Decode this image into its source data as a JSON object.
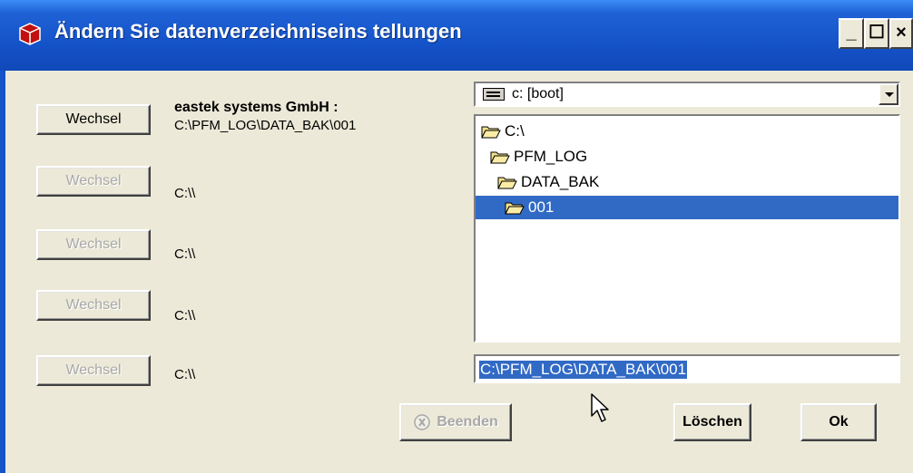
{
  "window": {
    "title": "Ändern Sie datenverzeichniseins tellungen",
    "minimize": "_",
    "maximize": "☐",
    "close": "×"
  },
  "rows": [
    {
      "button": "Wechsel",
      "enabled": true,
      "heading": "eastek systems GmbH :",
      "path": "C:\\PFM_LOG\\DATA_BAK\\001"
    },
    {
      "button": "Wechsel",
      "enabled": false,
      "path": "C:\\\\"
    },
    {
      "button": "Wechsel",
      "enabled": false,
      "path": "C:\\\\"
    },
    {
      "button": "Wechsel",
      "enabled": false,
      "path": "C:\\\\"
    },
    {
      "button": "Wechsel",
      "enabled": false,
      "path": "C:\\\\"
    }
  ],
  "drive_combo": {
    "value": "c: [boot]",
    "icon": "drive-icon"
  },
  "folder_tree": [
    {
      "label": "C:\\",
      "selected": false
    },
    {
      "label": "PFM_LOG",
      "selected": false
    },
    {
      "label": "DATA_BAK",
      "selected": false
    },
    {
      "label": "001",
      "selected": true
    }
  ],
  "path_field": {
    "value": "C:\\PFM_LOG\\DATA_BAK\\001"
  },
  "buttons": {
    "beenden": "Beenden",
    "loeschen": "Löschen",
    "ok": "Ok"
  },
  "colors": {
    "titlebar": "#1553c9",
    "selection": "#316ac5",
    "dialog": "#ece9d8"
  }
}
